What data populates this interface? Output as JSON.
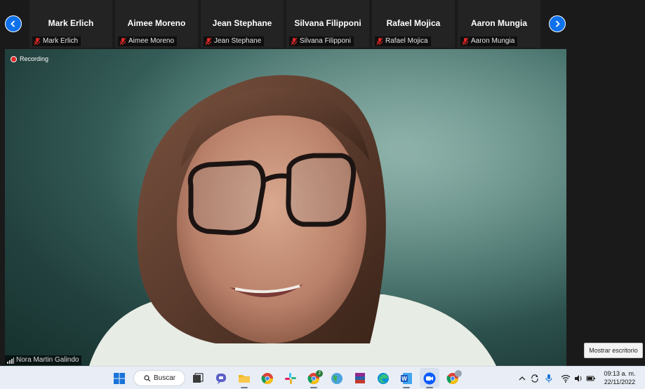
{
  "participants": [
    {
      "name": "Mark Erlich",
      "label": "Mark Erlich"
    },
    {
      "name": "Aimee Moreno",
      "label": "Aimee Moreno"
    },
    {
      "name": "Jean Stephane",
      "label": "Jean Stephane"
    },
    {
      "name": "Silvana Filipponi",
      "label": "Silvana Filipponi"
    },
    {
      "name": "Rafael Mojica",
      "label": "Rafael Mojica"
    },
    {
      "name": "Aaron Mungia",
      "label": "Aaron Mungia"
    }
  ],
  "video": {
    "recording_label": "Recording",
    "speaker_name": "Nora Martin Galindo"
  },
  "show_desktop_label": "Mostrar escritorio",
  "taskbar": {
    "search_label": "Buscar",
    "chrome_badge": "J",
    "time": "09:13 a. m.",
    "date": "22/11/2022"
  },
  "colors": {
    "accent": "#0e71eb",
    "mute_red": "#e02828"
  }
}
